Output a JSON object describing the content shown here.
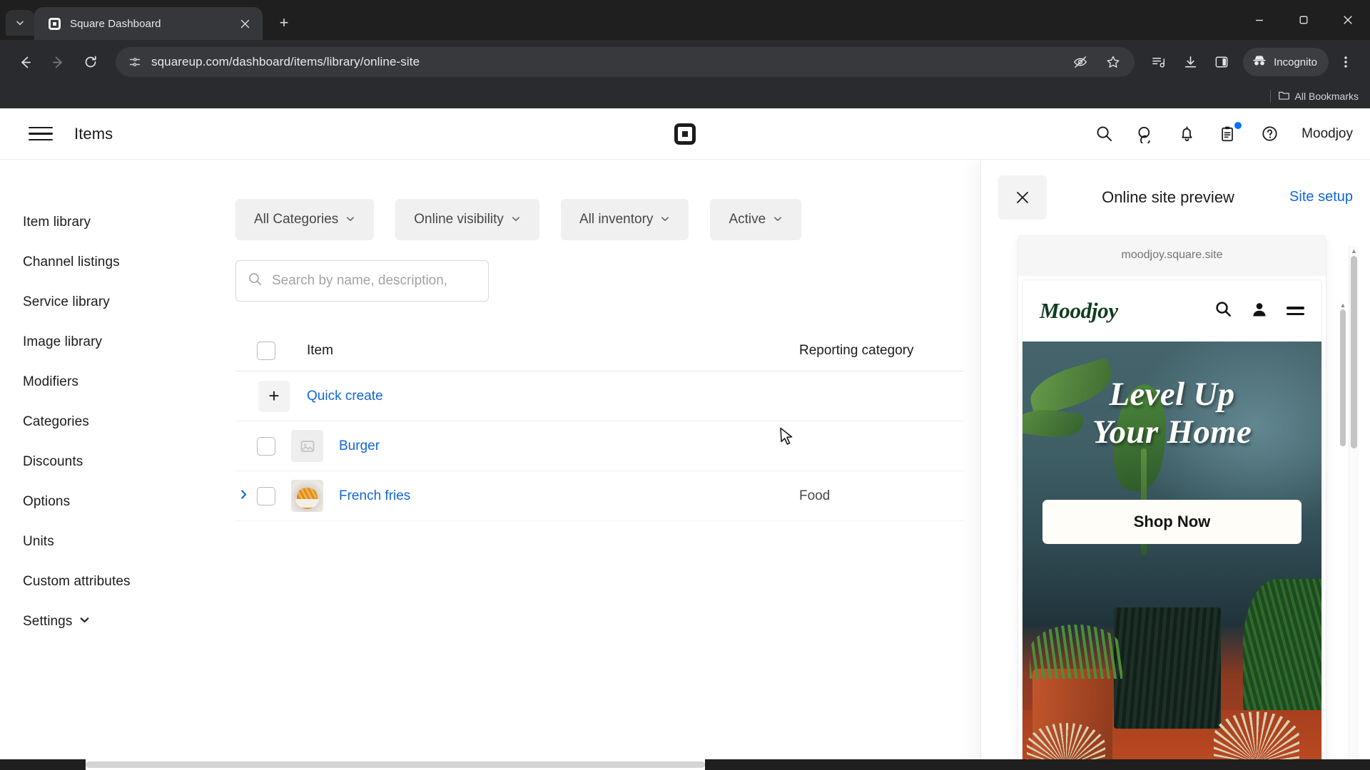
{
  "browser": {
    "tab": {
      "title": "Square Dashboard",
      "favicon_icon": "square-logo-icon",
      "close_icon": "close-icon"
    },
    "tab_list_chevron_icon": "chevron-down-icon",
    "new_tab_label": "+",
    "window_controls": {
      "minimize": "–",
      "maximize": "❐",
      "close": "✕"
    },
    "nav": {
      "back_icon": "arrow-left-icon",
      "forward_icon": "arrow-right-icon",
      "reload_icon": "reload-icon"
    },
    "omnibox": {
      "site_info_icon": "page-info-icon",
      "url": "squareup.com/dashboard/items/library/online-site",
      "hide_icon": "eye-off-icon",
      "bookmark_icon": "star-icon"
    },
    "toolbar_icons": [
      "media-control-icon",
      "download-icon",
      "side-panel-icon"
    ],
    "incognito": {
      "label": "Incognito",
      "icon": "incognito-icon"
    },
    "menu_icon": "three-dot-menu-icon",
    "bookmarks": {
      "folder_icon": "folder-icon",
      "label": "All Bookmarks"
    }
  },
  "app_header": {
    "menu_icon": "hamburger-menu-icon",
    "title": "Items",
    "logo_icon": "square-logo-icon",
    "icons": [
      "search-icon",
      "messages-icon",
      "bell-icon",
      "clipboard-icon",
      "help-icon"
    ],
    "clipboard_has_badge": true,
    "user_name": "Moodjoy"
  },
  "sidebar": {
    "items": [
      {
        "label": "Item library"
      },
      {
        "label": "Channel listings"
      },
      {
        "label": "Service library"
      },
      {
        "label": "Image library"
      },
      {
        "label": "Modifiers"
      },
      {
        "label": "Categories"
      },
      {
        "label": "Discounts"
      },
      {
        "label": "Options"
      },
      {
        "label": "Units"
      },
      {
        "label": "Custom attributes"
      },
      {
        "label": "Settings",
        "has_chevron": true
      }
    ]
  },
  "main": {
    "filters": [
      {
        "label": "All Categories"
      },
      {
        "label": "Online visibility"
      },
      {
        "label": "All inventory"
      },
      {
        "label": "Active"
      }
    ],
    "search": {
      "placeholder": "Search by name, description,",
      "icon": "search-icon"
    },
    "table": {
      "columns": {
        "item": "Item",
        "reporting_category": "Reporting category"
      },
      "quick_create": {
        "label": "Quick create",
        "icon": "plus-icon"
      },
      "rows": [
        {
          "name": "Burger",
          "reporting_category": "",
          "thumb": "image-placeholder-icon",
          "expandable": false
        },
        {
          "name": "French fries",
          "reporting_category": "Food",
          "thumb": "french-fries-photo",
          "expandable": true
        }
      ]
    }
  },
  "preview_panel": {
    "close_icon": "close-icon",
    "title": "Online site preview",
    "site_setup_link": "Site setup",
    "phone": {
      "url": "moodjoy.square.site",
      "site": {
        "brand": "Moodjoy",
        "nav_icons": [
          "search-icon",
          "account-icon",
          "menu-icon"
        ],
        "hero": {
          "title_line1": "Level Up",
          "title_line2": "Your Home",
          "cta_label": "Shop Now"
        }
      }
    }
  },
  "colors": {
    "link_blue": "#1166dd",
    "brand_green": "#0f3d1e",
    "chrome_dark": "#2a2b2e",
    "badge_blue": "#0b6efd"
  }
}
